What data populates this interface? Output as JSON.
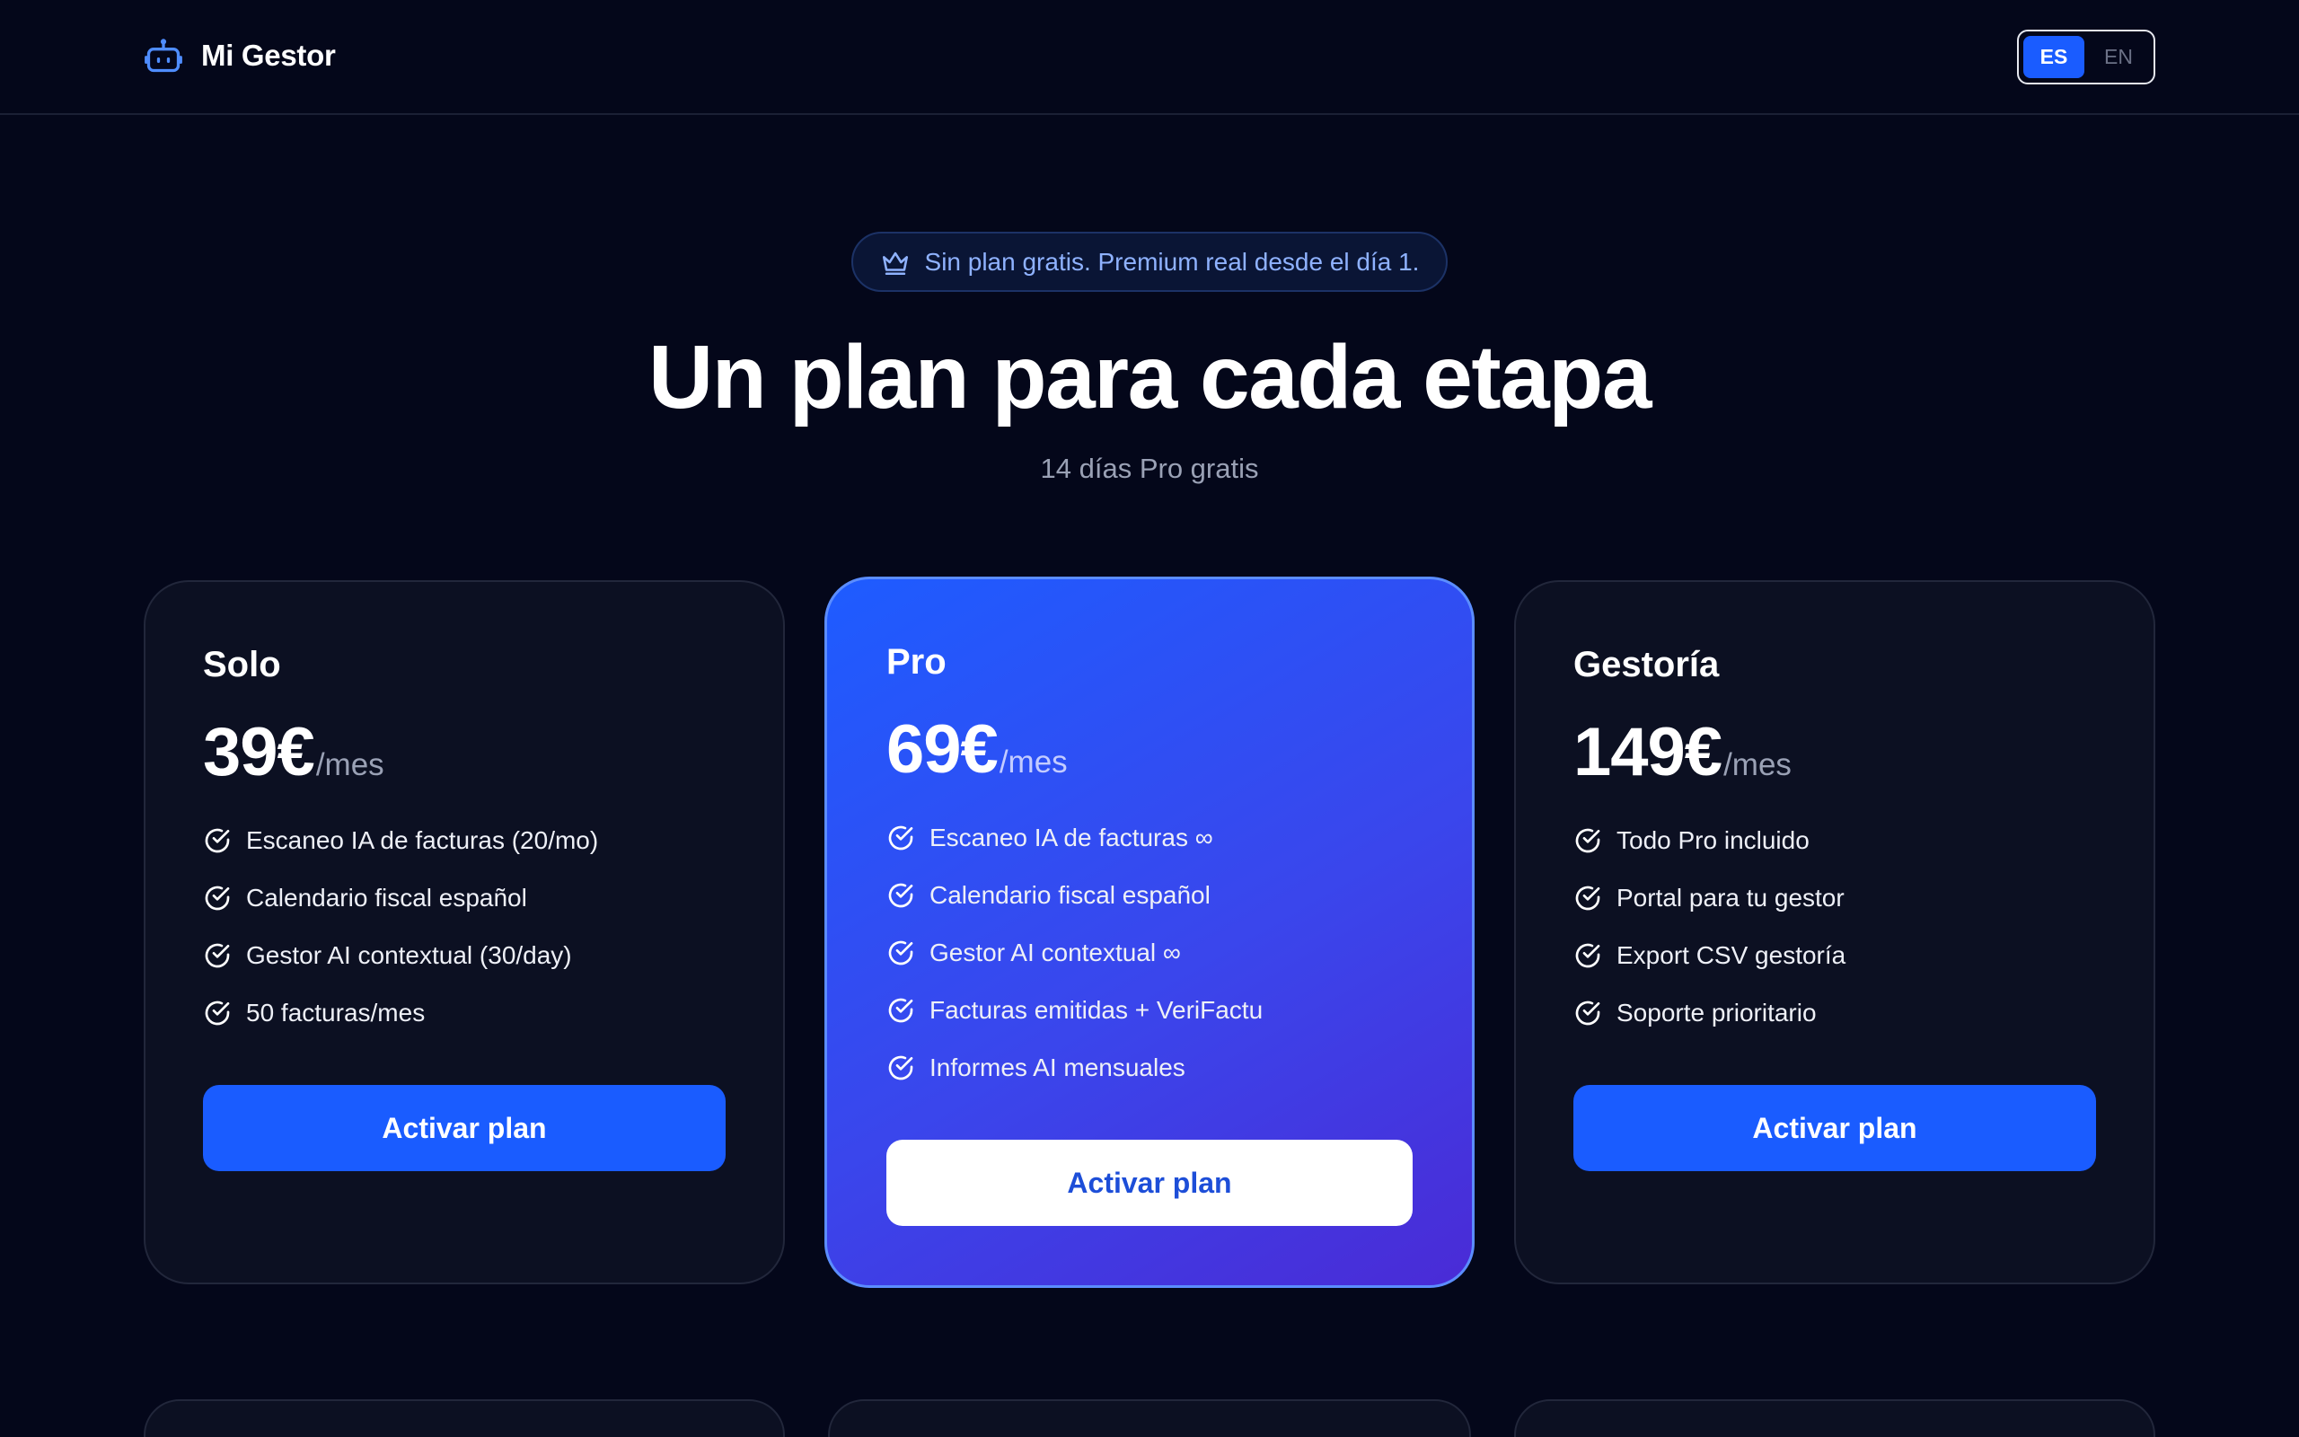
{
  "header": {
    "brand_name": "Mi Gestor",
    "brand_icon": "robot-icon",
    "lang": {
      "options": [
        "ES",
        "EN"
      ],
      "selected": "ES"
    }
  },
  "hero": {
    "badge_icon": "crown-icon",
    "badge_text": "Sin plan gratis. Premium real desde el día 1.",
    "title": "Un plan para cada etapa",
    "subtitle": "14 días Pro gratis"
  },
  "plans": [
    {
      "name": "Solo",
      "price": "39€",
      "period": "/mes",
      "features": [
        "Escaneo IA de facturas (20/mo)",
        "Calendario fiscal español",
        "Gestor AI contextual (30/day)",
        "50 facturas/mes"
      ],
      "cta": "Activar plan",
      "highlighted": false
    },
    {
      "name": "Pro",
      "price": "69€",
      "period": "/mes",
      "features": [
        "Escaneo IA de facturas ∞",
        "Calendario fiscal español",
        "Gestor AI contextual ∞",
        "Facturas emitidas + VeriFactu",
        "Informes AI mensuales"
      ],
      "cta": "Activar plan",
      "highlighted": true
    },
    {
      "name": "Gestoría",
      "price": "149€",
      "period": "/mes",
      "features": [
        "Todo Pro incluido",
        "Portal para tu gestor",
        "Export CSV gestoría",
        "Soporte prioritario"
      ],
      "cta": "Activar plan",
      "highlighted": false
    }
  ],
  "colors": {
    "background": "#04071a",
    "card": "#0c1022",
    "accent": "#1a5cff",
    "badge_text": "#8fb2ff",
    "muted": "#9aa1b5"
  }
}
